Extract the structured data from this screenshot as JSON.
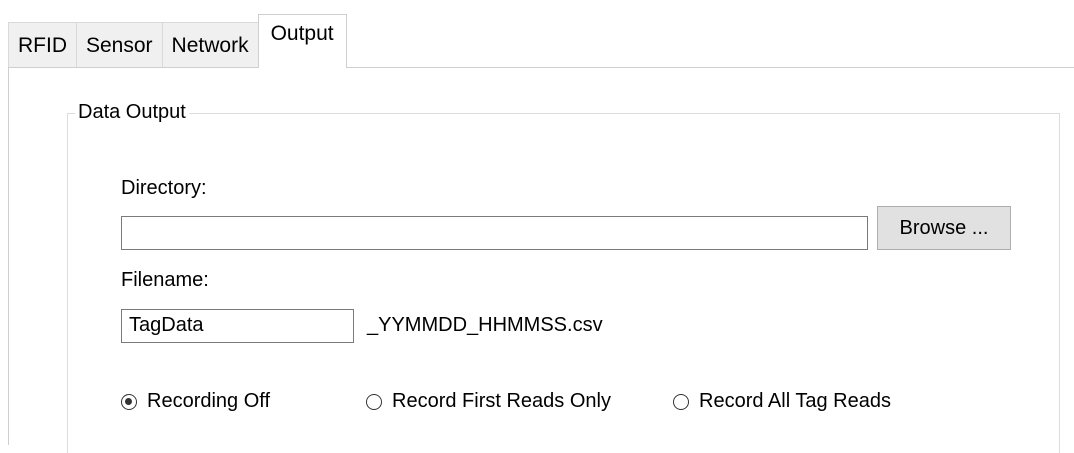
{
  "tabs": [
    {
      "label": "RFID",
      "active": false
    },
    {
      "label": "Sensor",
      "active": false
    },
    {
      "label": "Network",
      "active": false
    },
    {
      "label": "Output",
      "active": true
    }
  ],
  "data_output": {
    "group_title": "Data Output",
    "directory_label": "Directory:",
    "directory_value": "",
    "browse_label": "Browse ...",
    "filename_label": "Filename:",
    "filename_value": "TagData",
    "filename_suffix": "_YYMMDD_HHMMSS.csv",
    "recording_options": [
      {
        "label": "Recording Off",
        "selected": true
      },
      {
        "label": "Record First Reads Only",
        "selected": false
      },
      {
        "label": "Record All Tag Reads",
        "selected": false
      }
    ]
  }
}
